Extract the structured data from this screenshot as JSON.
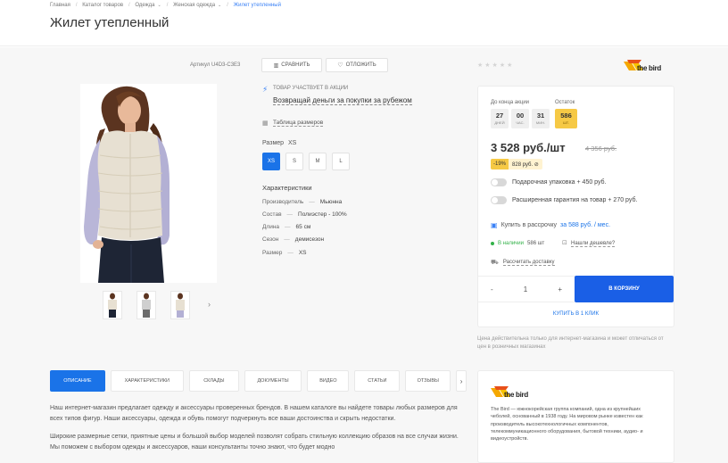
{
  "breadcrumb": {
    "items": [
      "Главная",
      "Каталог товаров",
      "Одежда",
      "Женская одежда",
      "Жилет утепленный"
    ]
  },
  "page": {
    "title": "Жилет утепленный"
  },
  "product": {
    "article": "Артикул U4D3-C3E3",
    "compare_label": "СРАВНИТЬ",
    "postpone_label": "ОТЛОЖИТЬ",
    "rating_stars": "★★★★★",
    "promo_label": "ТОВАР УЧАСТВУЕТ В АКЦИИ",
    "promo_link": "Возвращай деньги за покупки за рубежом",
    "size_table_link": "Таблица размеров",
    "size_label": "Размер",
    "size_selected": "XS",
    "sizes": [
      "XS",
      "S",
      "M",
      "L"
    ],
    "characteristics_title": "Характеристики",
    "characteristics": [
      {
        "name": "Производитель",
        "value": "Мьюнна"
      },
      {
        "name": "Состав",
        "value": "Полиэстер - 100%"
      },
      {
        "name": "Длина",
        "value": "65 см"
      },
      {
        "name": "Сезон",
        "value": "демисезон"
      },
      {
        "name": "Размер",
        "value": "XS"
      }
    ]
  },
  "brand": {
    "logo_text": "the bird",
    "accent": "#f5a800"
  },
  "buybox": {
    "countdown_label": "До конца акции",
    "stock_label": "Остаток",
    "countdown": [
      {
        "value": "27",
        "unit": "ДНЕЙ"
      },
      {
        "value": "00",
        "unit": "ЧАС."
      },
      {
        "value": "31",
        "unit": "МИН."
      }
    ],
    "stock": {
      "value": "586",
      "unit": "ШТ."
    },
    "price": "3 528 руб./шт",
    "old_price": "4 356 руб.",
    "discount_pct": "-19%",
    "discount_save": "828 руб. ⊘",
    "option_packaging": "Подарочная упаковка + 450 руб.",
    "option_warranty": "Расширенная гарантия на товар + 270 руб.",
    "credit_text": "Купить в рассрочку",
    "credit_link": "за 588 руб. / мес.",
    "availability_label": "В наличии",
    "availability_count": "586 шт",
    "cheaper_link": "Нашли дешевле?",
    "delivery_link": "Рассчитать доставку",
    "qty_minus": "-",
    "qty_value": "1",
    "qty_plus": "+",
    "cart_button": "В КОРЗИНУ",
    "oneclick": "КУПИТЬ В 1 КЛИК"
  },
  "price_note": "Цена действительна только для интернет-магазина и может отличаться от цен в розничных магазинах",
  "tabs": [
    "ОПИСАНИЕ",
    "ХАРАКТЕРИСТИКИ",
    "СКЛАДЫ",
    "ДОКУМЕНТЫ",
    "ВИДЕО",
    "СТАТЬИ",
    "ОТЗЫВЫ"
  ],
  "description": {
    "p1": "Наш интернет-магазин предлагает одежду и аксессуары проверенных брендов. В нашем каталоге вы найдете товары любых размеров для всех типов фигур. Наши аксессуары, одежда и обувь помогут подчеркнуть все ваши достоинства и скрыть недостатки.",
    "p2": "Широкие размерные сетки, приятные цены и большой выбор моделей позволят собрать стильную коллекцию образов на все случаи жизни. Мы поможем с выбором одежды и аксессуаров, наши консультанты точно знают, что будет модно"
  },
  "brand_card": {
    "text": "The Bird — южнокорейская группа компаний, одна из крупнейших чеболей, основанный в 1938 году. На мировом рынке известен как производитель высокотехнологичных компонентов, телекоммуникационного оборудования, бытовой техники, аудио- и видеоустройств."
  },
  "colors": {
    "accent": "#1a73e8",
    "stock": "#f6c945",
    "in_stock": "#33b249"
  }
}
